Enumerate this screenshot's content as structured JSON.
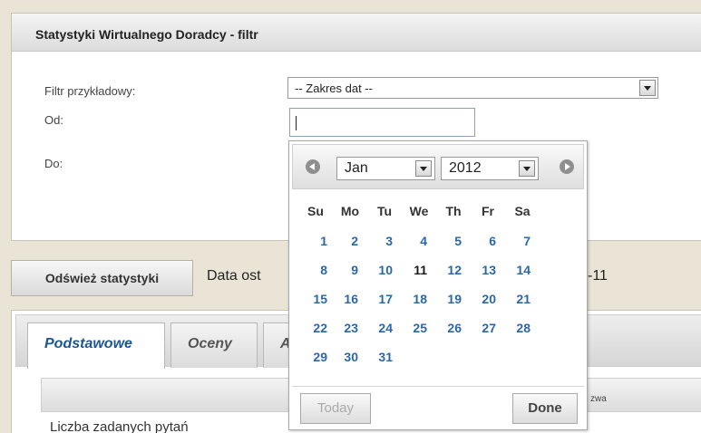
{
  "filter_panel": {
    "title": "Statystyki Wirtualnego Doradcy - filtr",
    "sample_filter_label": "Filtr przykładowy:",
    "sample_filter_value": "-- Zakres dat --",
    "from_label": "Od:",
    "from_value": "",
    "to_label": "Do:"
  },
  "refresh": {
    "button_label": "Odśwież statystyki",
    "info_prefix": "Data ost",
    "info_suffix": "-11"
  },
  "tabs": [
    {
      "label": "Podstawowe",
      "active": true
    },
    {
      "label": "Oceny",
      "active": false
    },
    {
      "label": "A",
      "active": false
    }
  ],
  "table": {
    "header_fragment": "zwa",
    "first_row_label": "Liczba zadanych pytań"
  },
  "datepicker": {
    "month": "Jan",
    "year": "2012",
    "weekdays": [
      "Su",
      "Mo",
      "Tu",
      "We",
      "Th",
      "Fr",
      "Sa"
    ],
    "weeks": [
      [
        "",
        "",
        "",
        "",
        "",
        "",
        ""
      ],
      [
        "1",
        "2",
        "3",
        "4",
        "5",
        "6",
        "7"
      ],
      [
        "8",
        "9",
        "10",
        "11",
        "12",
        "13",
        "14"
      ],
      [
        "15",
        "16",
        "17",
        "18",
        "19",
        "20",
        "21"
      ],
      [
        "22",
        "23",
        "24",
        "25",
        "26",
        "27",
        "28"
      ],
      [
        "29",
        "30",
        "31",
        "",
        "",
        "",
        ""
      ]
    ],
    "today": "11",
    "today_button": "Today",
    "done_button": "Done"
  }
}
